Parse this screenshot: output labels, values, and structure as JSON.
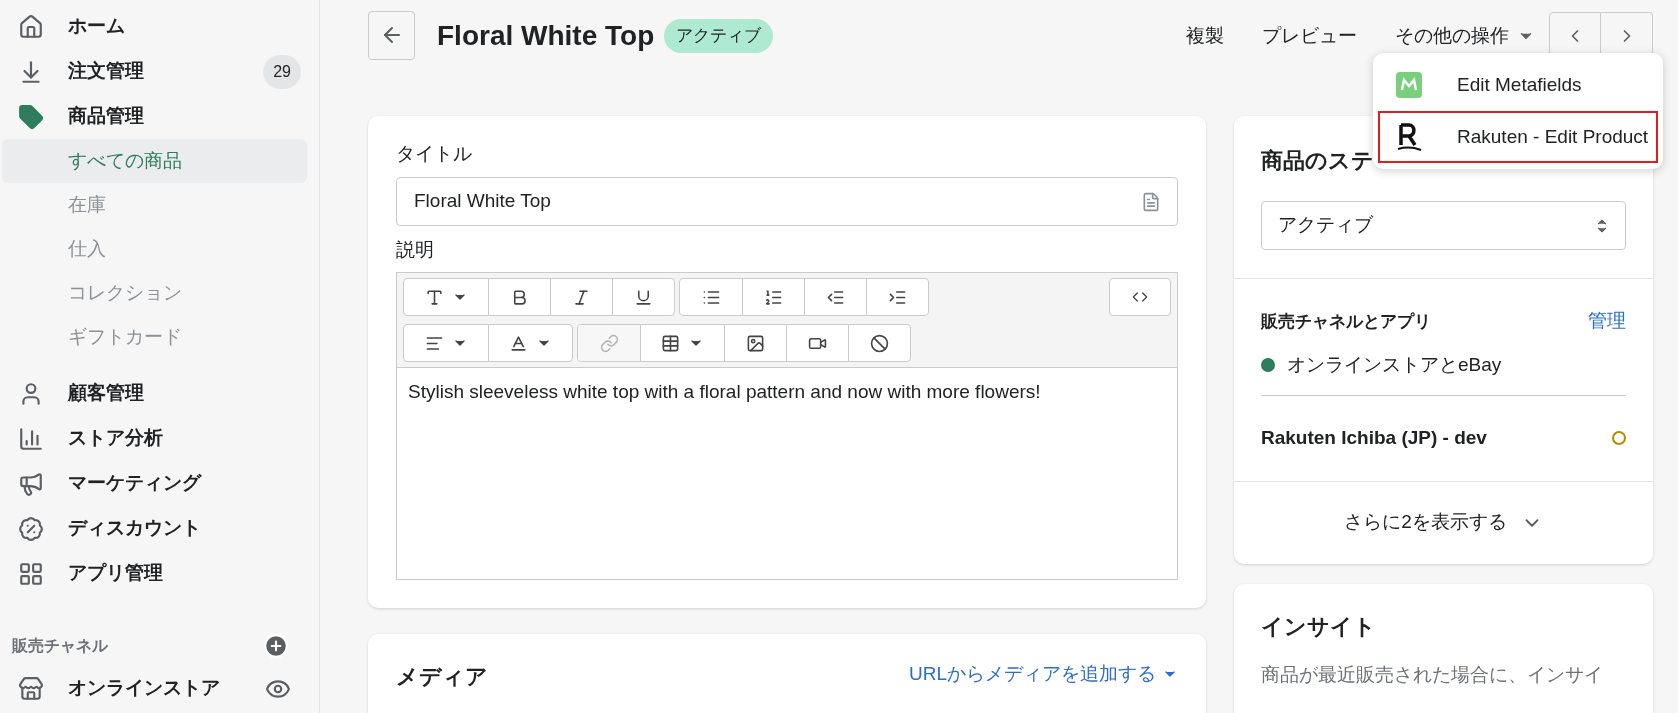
{
  "sidebar": {
    "items": [
      {
        "kind": "home",
        "label": "ホーム"
      },
      {
        "kind": "orders",
        "label": "注文管理",
        "badge": "29"
      },
      {
        "kind": "products",
        "label": "商品管理",
        "children": [
          {
            "label": "すべての商品",
            "selected": true
          },
          {
            "label": "在庫",
            "selected": false
          },
          {
            "label": "仕入",
            "selected": false
          },
          {
            "label": "コレクション",
            "selected": false
          },
          {
            "label": "ギフトカード",
            "selected": false
          }
        ]
      },
      {
        "kind": "customers",
        "label": "顧客管理"
      },
      {
        "kind": "analytics",
        "label": "ストア分析"
      },
      {
        "kind": "marketing",
        "label": "マーケティング"
      },
      {
        "kind": "discounts",
        "label": "ディスカウント"
      },
      {
        "kind": "apps",
        "label": "アプリ管理"
      }
    ],
    "channels_heading": "販売チャネル",
    "channels": [
      {
        "label": "オンラインストア"
      }
    ]
  },
  "header": {
    "title": "Floral White Top",
    "status": "アクティブ",
    "actions": [
      "複製",
      "プレビュー"
    ],
    "more": "その他の操作"
  },
  "menu": [
    {
      "kind": "metafields",
      "label": "Edit Metafields",
      "highlighted": false
    },
    {
      "kind": "rakuten",
      "label": "Rakuten - Edit Product",
      "highlighted": true
    }
  ],
  "product": {
    "title_label": "タイトル",
    "title_value": "Floral White Top",
    "description_label": "説明",
    "toolbar": [
      [
        [
          {
            "kind": "font",
            "disabled": false
          },
          {
            "kind": "bold",
            "disabled": false
          },
          {
            "kind": "italic",
            "disabled": false
          },
          {
            "kind": "underline",
            "disabled": false
          }
        ],
        [
          {
            "kind": "bullets",
            "disabled": false
          },
          {
            "kind": "numbers",
            "disabled": false
          },
          {
            "kind": "outdent",
            "disabled": false
          },
          {
            "kind": "indent",
            "disabled": false
          }
        ]
      ],
      [
        [
          {
            "kind": "align",
            "disabled": false
          },
          {
            "kind": "color",
            "disabled": false
          }
        ],
        [
          {
            "kind": "link",
            "disabled": true
          },
          {
            "kind": "table",
            "disabled": false
          },
          {
            "kind": "image",
            "disabled": false
          },
          {
            "kind": "video",
            "disabled": false
          },
          {
            "kind": "clear",
            "disabled": false
          }
        ]
      ]
    ],
    "description": "Stylish sleeveless white top with a floral pattern and now with more flowers!"
  },
  "media": {
    "title": "メディア",
    "add_link": "URLからメディアを追加する"
  },
  "status_card": {
    "title": "商品のステ",
    "status_value": "アクティブ",
    "channels_title": "販売チャネルとアプリ",
    "manage": "管理",
    "channels": [
      {
        "label": "オンラインストアとeBay",
        "kind": "dot",
        "color": "#2e7d5b",
        "bold": false
      },
      {
        "label": "Rakuten Ichiba (JP) - dev",
        "kind": "ring",
        "color": "#b98900",
        "bold": true
      }
    ],
    "show_more": "さらに2を表示する"
  },
  "insights": {
    "title": "インサイト",
    "text": "商品が最近販売された場合に、インサイ"
  }
}
